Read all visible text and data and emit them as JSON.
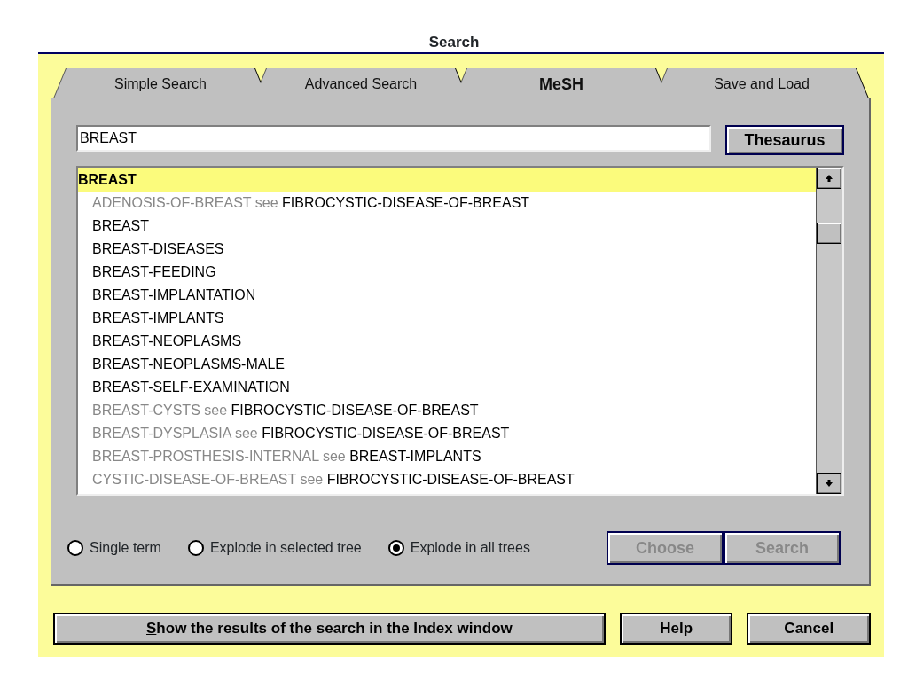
{
  "window": {
    "title": "Search"
  },
  "tabs": [
    {
      "label": "Simple Search",
      "selected": false
    },
    {
      "label": "Advanced Search",
      "selected": false
    },
    {
      "label": "MeSH",
      "selected": true
    },
    {
      "label": "Save and Load",
      "selected": false
    }
  ],
  "query": {
    "value": "BREAST"
  },
  "thesaurus_button": {
    "label": "Thesaurus",
    "disabled": false
  },
  "terms": [
    {
      "kind": "heading",
      "term": "BREAST",
      "selected": true
    },
    {
      "kind": "see",
      "term": "ADENOSIS-OF-BREAST",
      "connector": "see",
      "target": "FIBROCYSTIC-DISEASE-OF-BREAST",
      "selected": false
    },
    {
      "kind": "term",
      "term": "BREAST",
      "selected": false
    },
    {
      "kind": "term",
      "term": "BREAST-DISEASES",
      "selected": false
    },
    {
      "kind": "term",
      "term": "BREAST-FEEDING",
      "selected": false
    },
    {
      "kind": "term",
      "term": "BREAST-IMPLANTATION",
      "selected": false
    },
    {
      "kind": "term",
      "term": "BREAST-IMPLANTS",
      "selected": false
    },
    {
      "kind": "term",
      "term": "BREAST-NEOPLASMS",
      "selected": false
    },
    {
      "kind": "term",
      "term": "BREAST-NEOPLASMS-MALE",
      "selected": false
    },
    {
      "kind": "term",
      "term": "BREAST-SELF-EXAMINATION",
      "selected": false
    },
    {
      "kind": "see",
      "term": "BREAST-CYSTS",
      "connector": "see",
      "target": "FIBROCYSTIC-DISEASE-OF-BREAST",
      "selected": false
    },
    {
      "kind": "see",
      "term": "BREAST-DYSPLASIA",
      "connector": "see",
      "target": "FIBROCYSTIC-DISEASE-OF-BREAST",
      "selected": false
    },
    {
      "kind": "see",
      "term": "BREAST-PROSTHESIS-INTERNAL",
      "connector": "see",
      "target": "BREAST-IMPLANTS",
      "selected": false
    },
    {
      "kind": "see",
      "term": "CYSTIC-DISEASE-OF-BREAST",
      "connector": "see",
      "target": "FIBROCYSTIC-DISEASE-OF-BREAST",
      "selected": false
    }
  ],
  "options": [
    {
      "label": "Single term",
      "selected": false
    },
    {
      "label": "Explode in selected tree",
      "selected": false
    },
    {
      "label": "Explode in all trees",
      "selected": true
    }
  ],
  "panel_buttons": [
    {
      "label": "Choose",
      "disabled": true
    },
    {
      "label": "Search",
      "disabled": true
    }
  ],
  "footer_buttons": [
    {
      "label": "Show the results of the search in the Index window",
      "mnemonic": true,
      "wide": true
    },
    {
      "label": "Help",
      "mnemonic": false,
      "wide": false
    },
    {
      "label": "Cancel",
      "mnemonic": false,
      "wide": false
    }
  ]
}
